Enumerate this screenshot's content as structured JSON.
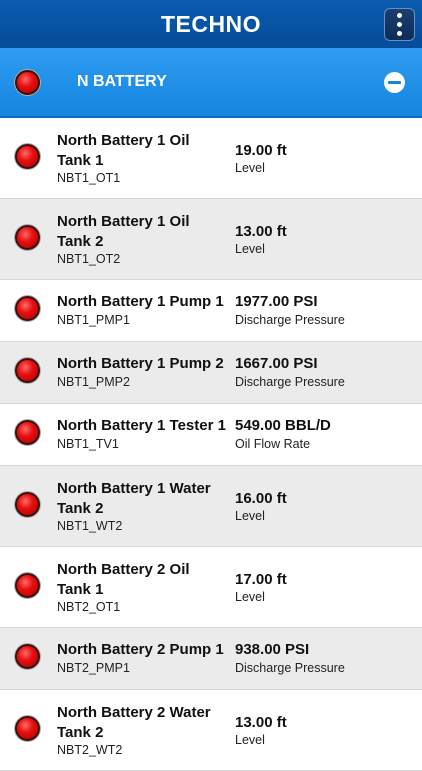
{
  "header": {
    "title": "TECHNO",
    "menu_icon": "vertical-dots-icon"
  },
  "group": {
    "label": "N BATTERY",
    "status": "alarm",
    "collapse_icon": "minus-circle-icon"
  },
  "rows": [
    {
      "name": "North Battery 1 Oil Tank 1",
      "code": "NBT1_OT1",
      "value": "19.00 ft",
      "metric": "Level",
      "status": "alarm"
    },
    {
      "name": "North Battery 1 Oil Tank 2",
      "code": "NBT1_OT2",
      "value": "13.00 ft",
      "metric": "Level",
      "status": "alarm"
    },
    {
      "name": "North Battery 1 Pump 1",
      "code": "NBT1_PMP1",
      "value": "1977.00 PSI",
      "metric": "Discharge Pressure",
      "status": "alarm"
    },
    {
      "name": "North Battery 1 Pump 2",
      "code": "NBT1_PMP2",
      "value": "1667.00 PSI",
      "metric": "Discharge Pressure",
      "status": "alarm"
    },
    {
      "name": "North Battery 1 Tester 1",
      "code": "NBT1_TV1",
      "value": "549.00 BBL/D",
      "metric": "Oil Flow Rate",
      "status": "alarm"
    },
    {
      "name": "North Battery 1 Water Tank 2",
      "code": "NBT1_WT2",
      "value": "16.00 ft",
      "metric": "Level",
      "status": "alarm"
    },
    {
      "name": "North Battery 2 Oil Tank 1",
      "code": "NBT2_OT1",
      "value": "17.00 ft",
      "metric": "Level",
      "status": "alarm"
    },
    {
      "name": "North Battery 2 Pump 1",
      "code": "NBT2_PMP1",
      "value": "938.00 PSI",
      "metric": "Discharge Pressure",
      "status": "alarm"
    },
    {
      "name": "North Battery 2 Water Tank 2",
      "code": "NBT2_WT2",
      "value": "13.00 ft",
      "metric": "Level",
      "status": "alarm"
    }
  ]
}
